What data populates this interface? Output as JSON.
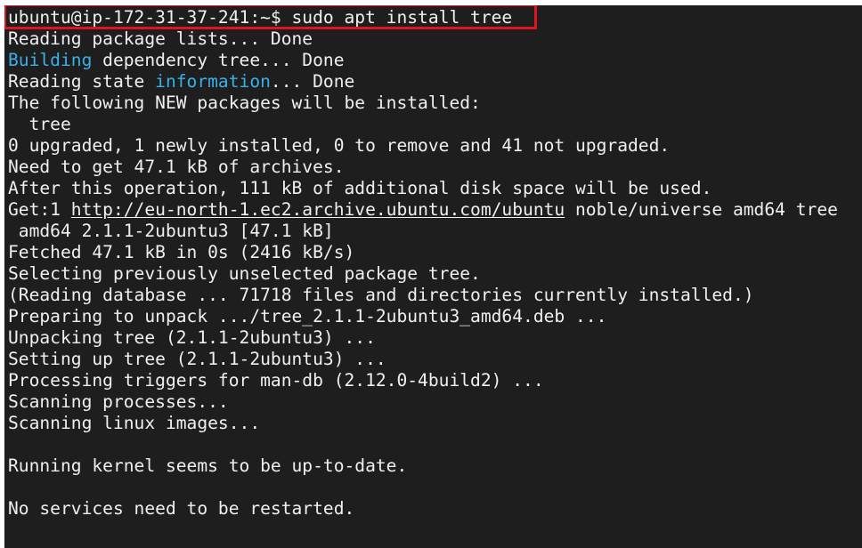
{
  "terminal": {
    "background": "#1e1e1e",
    "text_color": "#f0f0f0",
    "highlight_color": "#3ab0e8",
    "annotation_box_color": "#e0141e",
    "lines": [
      {
        "segments": [
          {
            "text": "ubuntu@ip-172-31-37-241:~$ sudo apt install tree"
          }
        ]
      },
      {
        "segments": [
          {
            "text": "Reading package lists... Done"
          }
        ]
      },
      {
        "segments": [
          {
            "text": "Building",
            "style": "highlight"
          },
          {
            "text": " dependency tree... Done"
          }
        ]
      },
      {
        "segments": [
          {
            "text": "Reading state "
          },
          {
            "text": "information",
            "style": "highlight"
          },
          {
            "text": "... Done"
          }
        ]
      },
      {
        "segments": [
          {
            "text": "The following NEW packages will be installed:"
          }
        ]
      },
      {
        "segments": [
          {
            "text": "  tree"
          }
        ]
      },
      {
        "segments": [
          {
            "text": "0 upgraded, 1 newly installed, 0 to remove and 41 not upgraded."
          }
        ]
      },
      {
        "segments": [
          {
            "text": "Need to get 47.1 kB of archives."
          }
        ]
      },
      {
        "segments": [
          {
            "text": "After this operation, 111 kB of additional disk space will be used."
          }
        ]
      },
      {
        "segments": [
          {
            "text": "Get:1 "
          },
          {
            "text": "http://eu-north-1.ec2.archive.ubuntu.com/ubuntu",
            "style": "link"
          },
          {
            "text": " noble/universe amd64 tree"
          }
        ]
      },
      {
        "segments": [
          {
            "text": " amd64 2.1.1-2ubuntu3 [47.1 kB]"
          }
        ]
      },
      {
        "segments": [
          {
            "text": "Fetched 47.1 kB in 0s (2416 kB/s)"
          }
        ]
      },
      {
        "segments": [
          {
            "text": "Selecting previously unselected package tree."
          }
        ]
      },
      {
        "segments": [
          {
            "text": "(Reading database ... 71718 files and directories currently installed.)"
          }
        ]
      },
      {
        "segments": [
          {
            "text": "Preparing to unpack .../tree_2.1.1-2ubuntu3_amd64.deb ..."
          }
        ]
      },
      {
        "segments": [
          {
            "text": "Unpacking tree (2.1.1-2ubuntu3) ..."
          }
        ]
      },
      {
        "segments": [
          {
            "text": "Setting up tree (2.1.1-2ubuntu3) ..."
          }
        ]
      },
      {
        "segments": [
          {
            "text": "Processing triggers for man-db (2.12.0-4build2) ..."
          }
        ]
      },
      {
        "segments": [
          {
            "text": "Scanning processes..."
          }
        ]
      },
      {
        "segments": [
          {
            "text": "Scanning linux images..."
          }
        ]
      },
      {
        "segments": [
          {
            "text": ""
          }
        ]
      },
      {
        "segments": [
          {
            "text": "Running kernel seems to be up-to-date."
          }
        ]
      },
      {
        "segments": [
          {
            "text": ""
          }
        ]
      },
      {
        "segments": [
          {
            "text": "No services need to be restarted."
          }
        ]
      }
    ]
  }
}
